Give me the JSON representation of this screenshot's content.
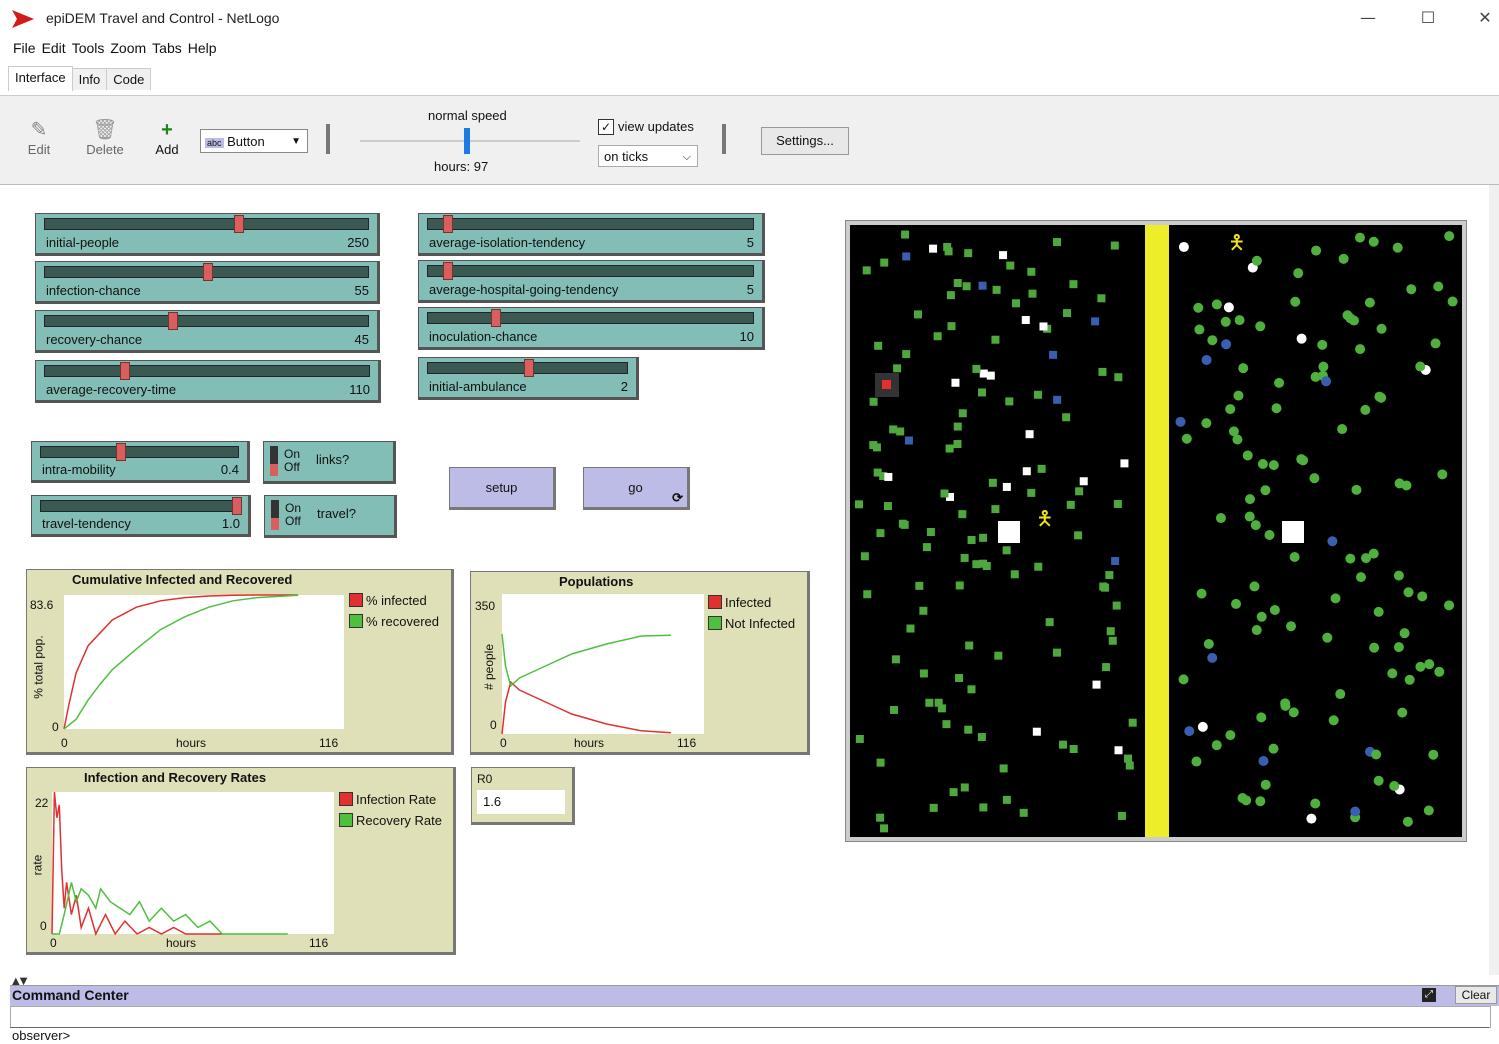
{
  "window": {
    "title": "epiDEM Travel and Control - NetLogo",
    "minimize": "—",
    "maximize": "☐",
    "close": "✕"
  },
  "menu": [
    "File",
    "Edit",
    "Tools",
    "Zoom",
    "Tabs",
    "Help"
  ],
  "tabs": [
    "Interface",
    "Info",
    "Code"
  ],
  "toolbar": {
    "edit": "Edit",
    "delete": "Delete",
    "add": "Add",
    "widget_type": "Button",
    "speed_label": "normal speed",
    "speed": 0.5,
    "ticks_label": "hours: 97",
    "view_updates_label": "view updates",
    "view_updates_checked": "✓",
    "update_mode": "on ticks",
    "settings_label": "Settings..."
  },
  "sliders": [
    {
      "label": "initial-people",
      "value": "250",
      "frac": 0.6
    },
    {
      "label": "infection-chance",
      "value": "55",
      "frac": 0.5
    },
    {
      "label": "recovery-chance",
      "value": "45",
      "frac": 0.39
    },
    {
      "label": "average-recovery-time",
      "value": "110",
      "frac": 0.24
    },
    {
      "label": "average-isolation-tendency",
      "value": "5",
      "frac": 0.05
    },
    {
      "label": "average-hospital-going-tendency",
      "value": "5",
      "frac": 0.05
    },
    {
      "label": "inoculation-chance",
      "value": "10",
      "frac": 0.2
    },
    {
      "label": "initial-ambulance",
      "value": "2",
      "frac": 0.5
    },
    {
      "label": "intra-mobility",
      "value": "0.4",
      "frac": 0.4
    },
    {
      "label": "travel-tendency",
      "value": "1.0",
      "frac": 1.0
    }
  ],
  "switches": [
    {
      "on": "On",
      "off": "Off",
      "label": "links?"
    },
    {
      "on": "On",
      "off": "Off",
      "label": "travel?"
    }
  ],
  "buttons": {
    "setup": "setup",
    "go": "go",
    "go_icon": "⟳"
  },
  "plots": {
    "cumulative": {
      "title": "Cumulative Infected and Recovered",
      "ylabel": "% total pop.",
      "xlabel": "hours",
      "ymax": "83.6",
      "ymin": "0",
      "xmin": "0",
      "xmax": "116",
      "legend": [
        {
          "name": "% infected",
          "color": "#e03030"
        },
        {
          "name": "% recovered",
          "color": "#4fbf3f"
        }
      ]
    },
    "populations": {
      "title": "Populations",
      "ylabel": "# people",
      "xlabel": "hours",
      "ymax": "350",
      "ymin": "0",
      "xmin": "0",
      "xmax": "116",
      "legend": [
        {
          "name": "Infected",
          "color": "#e03030"
        },
        {
          "name": "Not Infected",
          "color": "#4fbf3f"
        }
      ]
    },
    "rates": {
      "title": "Infection and Recovery Rates",
      "ylabel": "rate",
      "xlabel": "hours",
      "ymax": "22",
      "ymin": "0",
      "xmin": "0",
      "xmax": "116",
      "legend": [
        {
          "name": "Infection Rate",
          "color": "#e03030"
        },
        {
          "name": "Recovery Rate",
          "color": "#4fbf3f"
        }
      ]
    }
  },
  "monitor": {
    "label": "R0",
    "value": "1.6"
  },
  "command_center": {
    "title": "Command Center",
    "clear": "Clear",
    "prompt": "observer>"
  },
  "chart_data": [
    {
      "type": "line",
      "title": "Cumulative Infected and Recovered",
      "xlabel": "hours",
      "ylabel": "% total pop.",
      "xlim": [
        0,
        116
      ],
      "ylim": [
        0,
        83.6
      ],
      "series": [
        {
          "name": "% infected",
          "x": [
            0,
            2,
            5,
            10,
            15,
            20,
            30,
            40,
            50,
            60,
            70,
            80,
            97
          ],
          "values": [
            0,
            15,
            35,
            52,
            60,
            68,
            76,
            80,
            82,
            83,
            83.5,
            83.6,
            83.6
          ]
        },
        {
          "name": "% recovered",
          "x": [
            0,
            5,
            10,
            15,
            20,
            30,
            40,
            50,
            60,
            70,
            80,
            97
          ],
          "values": [
            0,
            6,
            18,
            28,
            37,
            50,
            62,
            70,
            76,
            80,
            82,
            83.4
          ]
        }
      ]
    },
    {
      "type": "line",
      "title": "Populations",
      "xlabel": "hours",
      "ylabel": "# people",
      "xlim": [
        0,
        116
      ],
      "ylim": [
        0,
        350
      ],
      "series": [
        {
          "name": "Infected",
          "x": [
            0,
            2,
            5,
            10,
            20,
            30,
            40,
            60,
            80,
            97
          ],
          "values": [
            0,
            80,
            130,
            110,
            90,
            70,
            50,
            25,
            8,
            3
          ]
        },
        {
          "name": "Not Infected",
          "x": [
            0,
            2,
            5,
            10,
            20,
            30,
            40,
            60,
            80,
            97
          ],
          "values": [
            250,
            170,
            120,
            140,
            160,
            180,
            200,
            225,
            245,
            247
          ]
        }
      ]
    },
    {
      "type": "line",
      "title": "Infection and Recovery Rates",
      "xlabel": "hours",
      "ylabel": "rate",
      "xlim": [
        0,
        116
      ],
      "ylim": [
        0,
        22
      ],
      "series": [
        {
          "name": "Infection Rate",
          "x": [
            0,
            1,
            2,
            3,
            4,
            5,
            6,
            8,
            10,
            12,
            15,
            18,
            22,
            26,
            30,
            35,
            40,
            45,
            50,
            55,
            60,
            65,
            70
          ],
          "values": [
            0,
            22,
            18,
            20,
            10,
            4,
            8,
            3,
            6,
            1,
            4,
            0,
            3,
            0,
            2,
            0,
            1,
            0,
            1,
            0,
            0,
            0,
            0
          ]
        },
        {
          "name": "Recovery Rate",
          "x": [
            0,
            3,
            5,
            8,
            10,
            12,
            15,
            18,
            20,
            24,
            28,
            32,
            36,
            40,
            45,
            50,
            55,
            60,
            65,
            70,
            80,
            97
          ],
          "values": [
            0,
            0,
            3,
            8,
            5,
            7,
            6,
            4,
            7,
            5,
            4,
            3,
            5,
            2,
            4,
            2,
            3,
            1,
            2,
            0,
            0,
            0
          ]
        }
      ]
    }
  ],
  "view": {
    "background": "#000000",
    "divider_color": "#eded2a"
  }
}
